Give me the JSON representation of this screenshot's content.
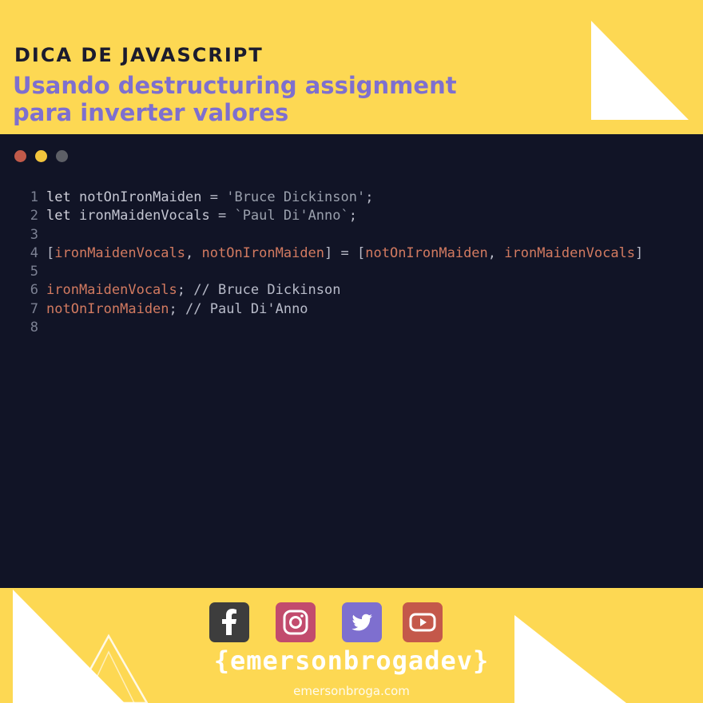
{
  "header": {
    "kicker": "DICA DE JAVASCRIPT",
    "title_line1": "Usando destructuring assignment",
    "title_line2": "para inverter valores"
  },
  "colors": {
    "background": "#fdd853",
    "editor_bg": "#111426",
    "title": "#7e6fcf",
    "dot_red": "#c15a4a",
    "dot_yellow": "#f2c43c",
    "dot_gray": "#5d5f66"
  },
  "code": {
    "line_numbers": [
      "1",
      "2",
      "3",
      "4",
      "5",
      "6",
      "7",
      "8"
    ],
    "l1": {
      "kw": "let",
      "var": "notOnIronMaiden",
      "op": " = ",
      "str": "'Bruce Dickinson'",
      "end": ";"
    },
    "l2": {
      "kw": "let",
      "var": "ironMaidenVocals",
      "op": " = ",
      "str": "`Paul Di'Anno`",
      "end": ";"
    },
    "l4": {
      "open1": "[",
      "a": "ironMaidenVocals",
      "sep": ", ",
      "b": "notOnIronMaiden",
      "close1": "]",
      "op": " = ",
      "open2": "[",
      "c": "notOnIronMaiden",
      "sep2": ", ",
      "d": "ironMaidenVocals",
      "close2": "]"
    },
    "l6": {
      "var": "ironMaidenVocals",
      "end": ";",
      "comment": " // Bruce Dickinson"
    },
    "l7": {
      "var": "notOnIronMaiden",
      "end": ";",
      "comment": " // Paul Di'Anno"
    }
  },
  "footer": {
    "social_icons": [
      "facebook-icon",
      "instagram-icon",
      "twitter-icon",
      "youtube-icon"
    ],
    "brand": "{emersonbrogadev}",
    "site": "emersonbroga.com"
  }
}
